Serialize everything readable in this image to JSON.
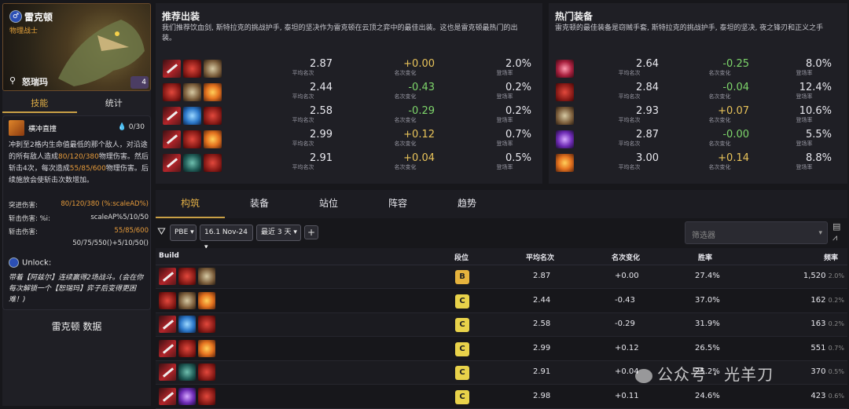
{
  "hero": {
    "name": "雷克顿",
    "role": "物理战士",
    "trait": "怒瑞玛",
    "cost": "4",
    "star_glyph": "♂",
    "trait_glyph": "⚲"
  },
  "left_tabs": {
    "skills": "技能",
    "stats": "统计"
  },
  "ability": {
    "name": "横冲直撞",
    "mana": "0/30",
    "desc_1": "冲刺至2格内生命值最低的那个敌人，对沿途的所有敌人造成",
    "desc_dmg": "80/120/380",
    "desc_2": "物理伤害。然后斩击4次，每次造成",
    "desc_dmg2": "55/85/600",
    "desc_3": "物理伤害。后续施放会使斩击次数增加。",
    "stats": [
      {
        "label": "突进伤害:",
        "value": "80/120/380 (%:scaleAD%)"
      },
      {
        "label": "斩击伤害: %i:",
        "value": "scaleAP%5/10/50"
      },
      {
        "label": "斩击伤害:",
        "value": "55/85/600"
      },
      {
        "label": "",
        "value": "50/75/550()+5/10/50()"
      }
    ],
    "unlock_label": "Unlock:",
    "unlock_text": "带着【阿兹尔】连续赢得2场战斗。(会在你每次解锁一个【恕瑞玛】弈子后变得更困难！)"
  },
  "data_title": "雷克顿 数据",
  "recommended": {
    "title": "推荐出装",
    "desc": "我们推荐饮血剑, 斯特拉克的挑战护手, 泰坦的坚决作为雷克顿在云顶之弈中的最佳出装。这也是雷克顿最热门的出装。",
    "sub_avg": "平均名次",
    "sub_delta": "名次变化",
    "sub_rate": "登场率",
    "rows": [
      {
        "items": [
          "sword",
          "red",
          "claw"
        ],
        "avg": "2.87",
        "delta": "+0.00",
        "dir": "pos",
        "rate": "2.0%"
      },
      {
        "items": [
          "red",
          "claw",
          "orange"
        ],
        "avg": "2.44",
        "delta": "-0.43",
        "dir": "neg",
        "rate": "0.2%"
      },
      {
        "items": [
          "sword",
          "blue",
          "red"
        ],
        "avg": "2.58",
        "delta": "-0.29",
        "dir": "neg",
        "rate": "0.2%"
      },
      {
        "items": [
          "sword",
          "red",
          "orange"
        ],
        "avg": "2.99",
        "delta": "+0.12",
        "dir": "pos",
        "rate": "0.7%"
      },
      {
        "items": [
          "sword",
          "green",
          "red"
        ],
        "avg": "2.91",
        "delta": "+0.04",
        "dir": "pos",
        "rate": "0.5%"
      }
    ]
  },
  "popular": {
    "title": "热门装备",
    "desc": "雷克顿的最佳装备是窃贼手套, 斯特拉克的挑战护手, 泰坦的坚决, 夜之锋刃和正义之手",
    "rows": [
      {
        "item": "pink",
        "avg": "2.64",
        "delta": "-0.25",
        "dir": "neg",
        "rate": "8.0%"
      },
      {
        "item": "red",
        "avg": "2.84",
        "delta": "-0.04",
        "dir": "neg",
        "rate": "12.4%"
      },
      {
        "item": "claw",
        "avg": "2.93",
        "delta": "+0.07",
        "dir": "pos",
        "rate": "10.6%"
      },
      {
        "item": "purple",
        "avg": "2.87",
        "delta": "-0.00",
        "dir": "neg",
        "rate": "5.5%"
      },
      {
        "item": "orange",
        "avg": "3.00",
        "delta": "+0.14",
        "dir": "pos",
        "rate": "8.8%"
      }
    ]
  },
  "tabs": [
    "构筑",
    "装备",
    "站位",
    "阵容",
    "趋势"
  ],
  "filters": {
    "patch": "PBE",
    "range": "16.1 Nov-24",
    "recent": "最近 3 天",
    "plus": "+",
    "search_placeholder": "筛选器"
  },
  "table": {
    "headers": {
      "build": "Build",
      "tier": "段位",
      "avg": "平均名次",
      "delta": "名次变化",
      "win": "胜率",
      "freq": "频率"
    },
    "rows": [
      {
        "items": [
          "sword",
          "red",
          "claw"
        ],
        "tier": "B",
        "avg": "2.87",
        "delta": "+0.00",
        "dir": "pos",
        "win": "27.4%",
        "count": "1,520",
        "pct": "2.0%"
      },
      {
        "items": [
          "red",
          "claw",
          "orange"
        ],
        "tier": "C",
        "avg": "2.44",
        "delta": "-0.43",
        "dir": "neg",
        "win": "37.0%",
        "count": "162",
        "pct": "0.2%"
      },
      {
        "items": [
          "sword",
          "blue",
          "red"
        ],
        "tier": "C",
        "avg": "2.58",
        "delta": "-0.29",
        "dir": "neg",
        "win": "31.9%",
        "count": "163",
        "pct": "0.2%"
      },
      {
        "items": [
          "sword",
          "red",
          "orange"
        ],
        "tier": "C",
        "avg": "2.99",
        "delta": "+0.12",
        "dir": "pos",
        "win": "26.5%",
        "count": "551",
        "pct": "0.7%"
      },
      {
        "items": [
          "sword",
          "green",
          "red"
        ],
        "tier": "C",
        "avg": "2.91",
        "delta": "+0.04",
        "dir": "pos",
        "win": "25.2%",
        "count": "370",
        "pct": "0.5%"
      },
      {
        "items": [
          "sword",
          "purple",
          "red"
        ],
        "tier": "C",
        "avg": "2.98",
        "delta": "+0.11",
        "dir": "pos",
        "win": "24.6%",
        "count": "423",
        "pct": "0.6%"
      }
    ]
  },
  "colors": {
    "tier_B": "#e6b33d",
    "tier_C": "#e8d24a",
    "accent": "#e3b046"
  },
  "watermark": "公众号 · 光羊刀"
}
